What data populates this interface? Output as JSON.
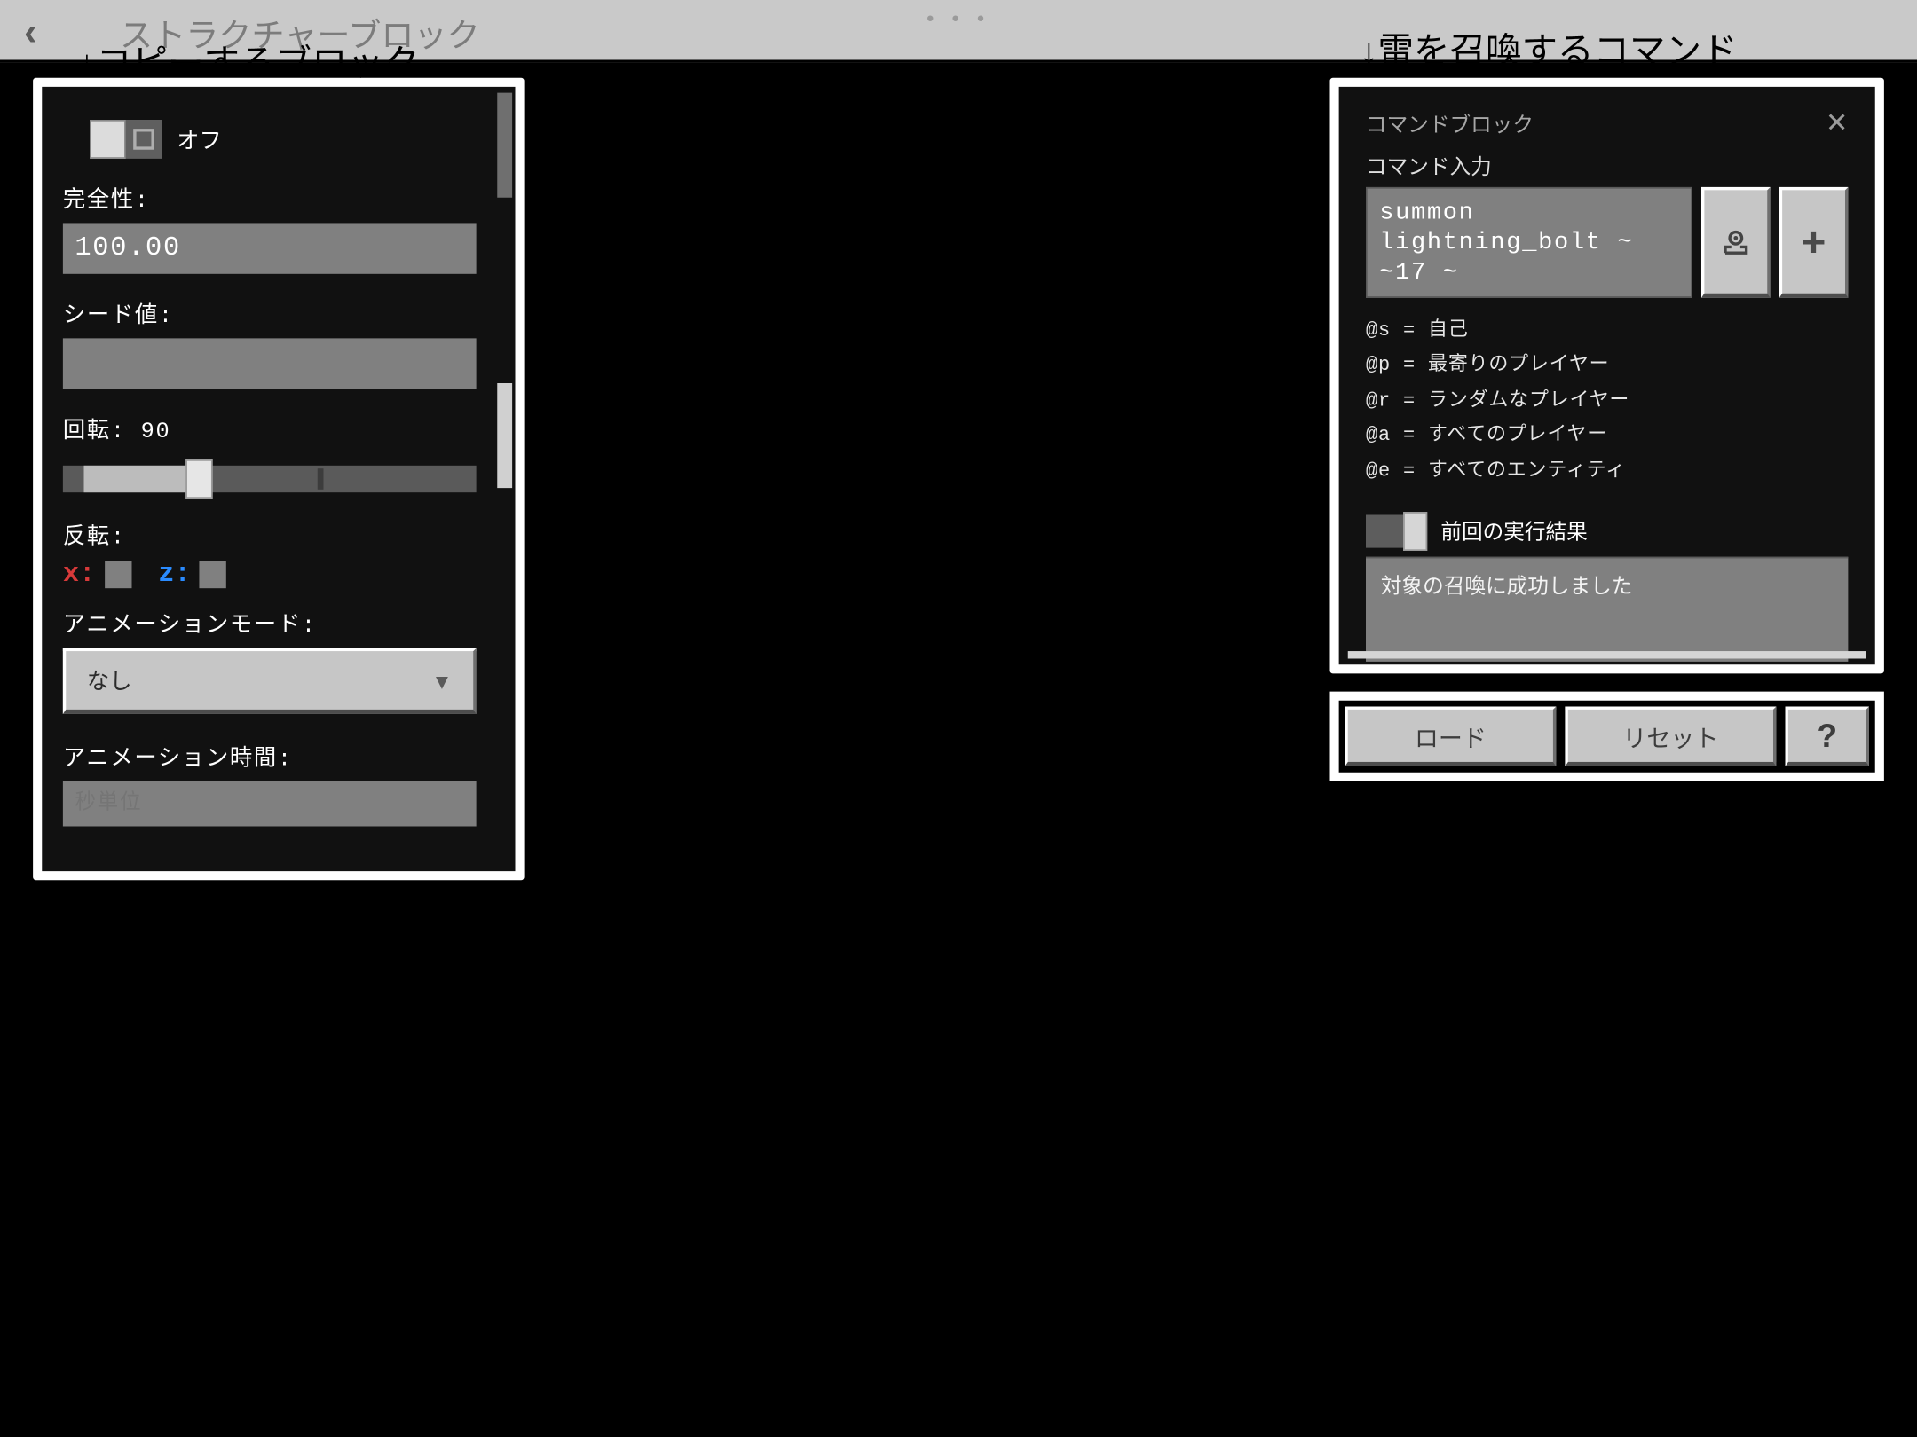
{
  "sysbar": {
    "faint_title": "ストラクチャーブロック",
    "dots": "• • •"
  },
  "overlay": {
    "left": "↓コピーするブロック",
    "right": "↓雷を召喚するコマンド"
  },
  "left_panel": {
    "toggle_off_label": "オフ",
    "integrity_label": "完全性:",
    "integrity_value": "100.00",
    "seed_label": "シード値:",
    "seed_value": "",
    "rotation_label": "回転: 90",
    "mirror_label": "反転:",
    "axis_x_label": "x:",
    "axis_z_label": "z:",
    "anim_mode_label": "アニメーションモード:",
    "anim_mode_value": "なし",
    "anim_time_label": "アニメーション時間:",
    "anim_time_placeholder": "秒単位"
  },
  "right_panel": {
    "header_title": "コマンドブロック",
    "input_section_label": "コマンド入力",
    "command_text": "summon lightning_bolt ~ ~17 ~",
    "hints": [
      "@s  =  自己",
      "@p  =  最寄りのプレイヤー",
      "@r  =  ランダムなプレイヤー",
      "@a  =  すべてのプレイヤー",
      "@e  =  すべてのエンティティ"
    ],
    "prev_result_label": "前回の実行結果",
    "result_text": "対象の召喚に成功しました"
  },
  "buttons": {
    "load": "ロード",
    "reset": "リセット",
    "help": "?"
  }
}
